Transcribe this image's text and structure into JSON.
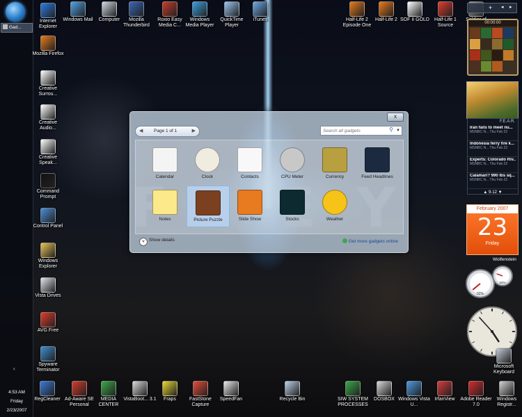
{
  "desktop_icons_left": [
    {
      "label": "Internet Explorer",
      "icon": "internet-explorer-icon",
      "color": "#2a7ae2"
    },
    {
      "label": "Mozilla Firefox",
      "icon": "firefox-icon",
      "color": "#e57a1a"
    },
    {
      "label": "Creative Surrou...",
      "icon": "creative-icon",
      "color": "#ffffff"
    },
    {
      "label": "Creative Audio...",
      "icon": "creative-icon",
      "color": "#ffffff"
    },
    {
      "label": "Creative Speak...",
      "icon": "creative-icon",
      "color": "#ffffff"
    },
    {
      "label": "Command Prompt",
      "icon": "command-prompt-icon",
      "color": "#111111"
    },
    {
      "label": "Control Panel",
      "icon": "control-panel-icon",
      "color": "#4a8ed8"
    },
    {
      "label": "Windows Explorer",
      "icon": "explorer-icon",
      "color": "#e8c458"
    },
    {
      "label": "Vista Drives",
      "icon": "drives-icon",
      "color": "#dfe6ee"
    },
    {
      "label": "AVG Free",
      "icon": "avg-icon",
      "color": "#e23a2a"
    },
    {
      "label": "Spyware Terminator",
      "icon": "spyware-icon",
      "color": "#3c8ed0"
    }
  ],
  "desktop_icons_top": [
    {
      "label": "Windows Mail",
      "icon": "mail-icon",
      "color": "#4ea3e6"
    },
    {
      "label": "Computer",
      "icon": "computer-icon",
      "color": "#cfd8e4"
    },
    {
      "label": "Mozilla Thunderbird",
      "icon": "thunderbird-icon",
      "color": "#3866b8"
    },
    {
      "label": "Roxio Easy Media C...",
      "icon": "roxio-icon",
      "color": "#c83a2a"
    },
    {
      "label": "Windows Media Player",
      "icon": "media-player-icon",
      "color": "#3aa0e0"
    },
    {
      "label": "QuickTime Player",
      "icon": "quicktime-icon",
      "color": "#9ac4f0"
    },
    {
      "label": "iTunes",
      "icon": "itunes-icon",
      "color": "#6aa8e8"
    },
    {
      "label": "Half-Life 2 Episode One",
      "icon": "half-life-icon",
      "color": "#e87a1a"
    },
    {
      "label": "Half-Life 2",
      "icon": "half-life-icon",
      "color": "#e87a1a"
    },
    {
      "label": "SOF II GOLD",
      "icon": "sof-icon",
      "color": "#ffffff"
    },
    {
      "label": "Half-Life 1 Source",
      "icon": "half-life-icon",
      "color": "#e23a2a"
    },
    {
      "label": "Soldier of",
      "icon": "sof-icon",
      "color": "#9a9a9a"
    }
  ],
  "desktop_icons_bottom": [
    {
      "label": "RegCleaner",
      "icon": "regcleaner-icon",
      "color": "#3a7ad8"
    },
    {
      "label": "Ad-Aware SE Personal",
      "icon": "adaware-icon",
      "color": "#d83a2a"
    },
    {
      "label": "MEDIA CENTER",
      "icon": "media-center-icon",
      "color": "#3aa848"
    },
    {
      "label": "VistaBoot... 3.1",
      "icon": "vistaboot-icon",
      "color": "#d8d8d8"
    },
    {
      "label": "Fraps",
      "icon": "fraps-icon",
      "color": "#e8d830"
    },
    {
      "label": "FastStone Capture",
      "icon": "faststone-icon",
      "color": "#e84a3a"
    },
    {
      "label": "SpeedFan",
      "icon": "speedfan-icon",
      "color": "#e8e8e8"
    },
    {
      "label": "Recycle Bin",
      "icon": "recycle-bin-icon",
      "color": "#bcd0e6"
    },
    {
      "label": "SIW SYSTEM PROCESSES",
      "icon": "siw-icon",
      "color": "#3aa848"
    },
    {
      "label": "DOSBOX",
      "icon": "dosbox-icon",
      "color": "#d8d8d8"
    },
    {
      "label": "Windows Vista U...",
      "icon": "vista-icon",
      "color": "#4a9ae0"
    },
    {
      "label": "IrfanView",
      "icon": "irfanview-icon",
      "color": "#d83a3a"
    },
    {
      "label": "Adobe Reader 7.0",
      "icon": "adobe-reader-icon",
      "color": "#d82a2a"
    },
    {
      "label": "Windows Registr...",
      "icon": "registry-icon",
      "color": "#d0d0d0"
    }
  ],
  "taskbar": {
    "task_label": "Gad...",
    "clock": {
      "time": "4:53 AM",
      "day": "Friday",
      "date": "2/23/2007"
    }
  },
  "wallpaper_text": [
    "F",
    "E",
    "Y"
  ],
  "gadget_gallery": {
    "close_label": "x",
    "page_label": "Page 1 of 1",
    "search_placeholder": "Search all gadgets",
    "items": [
      {
        "label": "Calendar",
        "icon": "calendar-icon",
        "color": "#f4f4f4"
      },
      {
        "label": "Clock",
        "icon": "clock-icon",
        "color": "#f0ece0"
      },
      {
        "label": "Contacts",
        "icon": "contacts-icon",
        "color": "#f8f8f8"
      },
      {
        "label": "CPU Meter",
        "icon": "cpu-meter-icon",
        "color": "#c8c8c8"
      },
      {
        "label": "Currency",
        "icon": "currency-icon",
        "color": "#b8a040"
      },
      {
        "label": "Feed Headlines",
        "icon": "feed-headlines-icon",
        "color": "#1c2a40"
      },
      {
        "label": "Notes",
        "icon": "notes-icon",
        "color": "#fbe98a"
      },
      {
        "label": "Picture Puzzle",
        "icon": "picture-puzzle-icon",
        "color": "#7a4020"
      },
      {
        "label": "Slide Show",
        "icon": "slide-show-icon",
        "color": "#e87a20"
      },
      {
        "label": "Stocks",
        "icon": "stocks-icon",
        "color": "#0c2a30"
      },
      {
        "label": "Weather",
        "icon": "weather-icon",
        "color": "#f6c418"
      }
    ],
    "show_details_label": "Show details",
    "get_more_label": "Get more gadgets online"
  },
  "sidebar_gadgets": {
    "sidebar_controls": {
      "add": "+"
    },
    "puzzle_timer": "00:00:00",
    "feed": {
      "title": "F.E.A.R.",
      "items": [
        {
          "title": "Iran fails to meet nu...",
          "source": "MSNBC N...   Thu Feb 22"
        },
        {
          "title": "Indonesia ferry fire k...",
          "source": "MSNBC N...   Thu Feb 22"
        },
        {
          "title": "Experts: Colorado Riv...",
          "source": "MSNBC N...   Thu Feb 22"
        },
        {
          "title": "Calamari? 990 lbs sq...",
          "source": "MSNBC N...   Thu Feb 22"
        }
      ],
      "pager": "9-12"
    },
    "calendar": {
      "month": "February 2007",
      "day_number": "23",
      "weekday": "Friday"
    },
    "wolfenstein_label": "Wolfenstein",
    "cpu_meter": {
      "cpu_percent": 2,
      "memory_percent": 24,
      "cpu_label": "02%",
      "mem_label": "24%"
    },
    "clock": {
      "hour": 4,
      "minute": 53
    }
  },
  "right_edge_icons": [
    {
      "label": "Microsoft Keyboard",
      "icon": "keyboard-icon",
      "color": "#c0c8d4"
    }
  ]
}
